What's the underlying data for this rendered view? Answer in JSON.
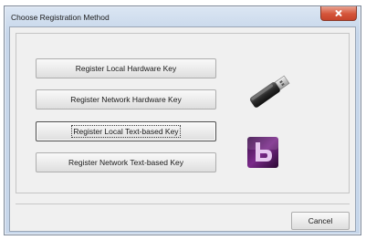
{
  "window": {
    "title": "Choose Registration Method"
  },
  "buttons": {
    "register_local_hardware": "Register Local Hardware Key",
    "register_network_hardware": "Register Network Hardware Key",
    "register_local_text": "Register Local Text-based Key",
    "register_network_text": "Register Network Text-based Key",
    "cancel": "Cancel"
  },
  "icons": {
    "usb": "usb-key-icon",
    "text_key": "text-key-b-icon",
    "close": "close-icon"
  },
  "colors": {
    "close_button": "#d5553a",
    "title_bar": "#c6d6ea",
    "text_key_icon": "#7a2a8a"
  }
}
